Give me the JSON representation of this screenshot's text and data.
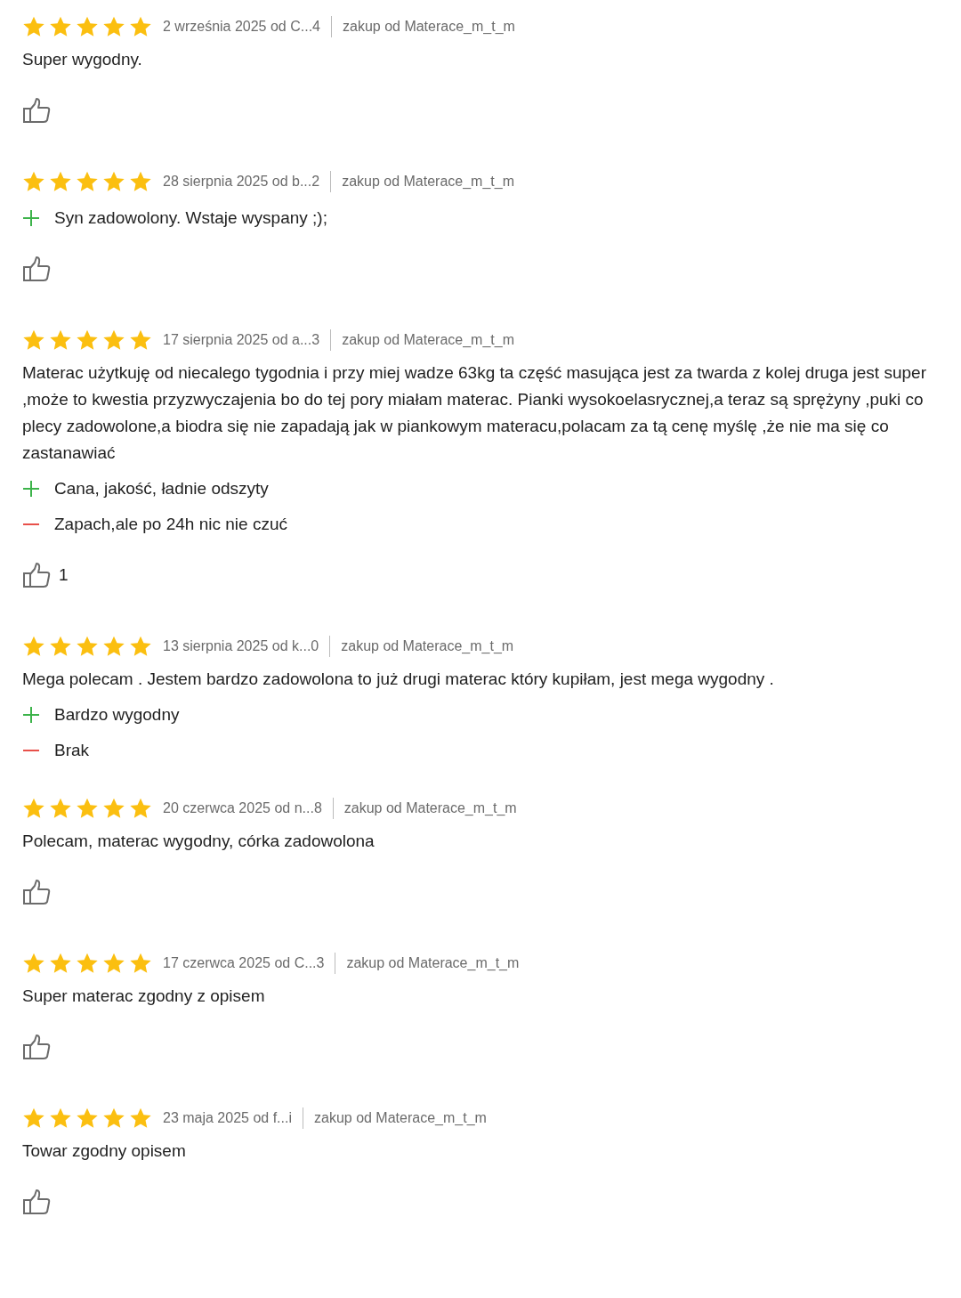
{
  "reviews": [
    {
      "stars": 5,
      "date": "2 września 2025 od C...4",
      "seller": "zakup od Materace_m_t_m",
      "text": "Super wygodny.",
      "has_like_button": true
    },
    {
      "stars": 5,
      "date": "28 sierpnia 2025 od b...2",
      "seller": "zakup od Materace_m_t_m",
      "pros": [
        "Syn zadowolony. Wstaje wyspany ;);"
      ],
      "has_like_button": true
    },
    {
      "stars": 5,
      "date": "17 sierpnia 2025 od a...3",
      "seller": "zakup od Materace_m_t_m",
      "text": "Materac użytkuję od niecalego tygodnia i przy miej wadze 63kg ta część masująca jest za twarda z kolej druga jest super ,może to kwestia przyzwyczajenia bo do tej pory miałam materac. Pianki wysokoelasrycznej,a teraz są sprężyny ,puki co plecy zadowolone,a biodra się nie zapadają jak w piankowym materacu,polacam za tą cenę myślę ,że nie ma się co zastanawiać",
      "pros": [
        "Cana, jakość, ładnie odszyty"
      ],
      "cons": [
        "Zapach,ale po 24h nic nie czuć"
      ],
      "has_like_button": true,
      "likes": "1"
    },
    {
      "stars": 5,
      "date": "13 sierpnia 2025 od k...0",
      "seller": "zakup od Materace_m_t_m",
      "text": "Mega polecam . Jestem bardzo zadowolona to już drugi materac który kupiłam, jest mega wygodny .",
      "pros": [
        "Bardzo wygodny"
      ],
      "cons": [
        "Brak"
      ],
      "has_like_button": false
    },
    {
      "stars": 5,
      "date": "20 czerwca 2025 od n...8",
      "seller": "zakup od Materace_m_t_m",
      "text": "Polecam, materac wygodny, córka zadowolona",
      "has_like_button": true
    },
    {
      "stars": 5,
      "date": "17 czerwca 2025 od C...3",
      "seller": "zakup od Materace_m_t_m",
      "text": "Super materac zgodny z opisem",
      "has_like_button": true
    },
    {
      "stars": 5,
      "date": "23 maja 2025 od f...i",
      "seller": "zakup od Materace_m_t_m",
      "text": "Towar zgodny opisem",
      "has_like_button": true
    }
  ]
}
